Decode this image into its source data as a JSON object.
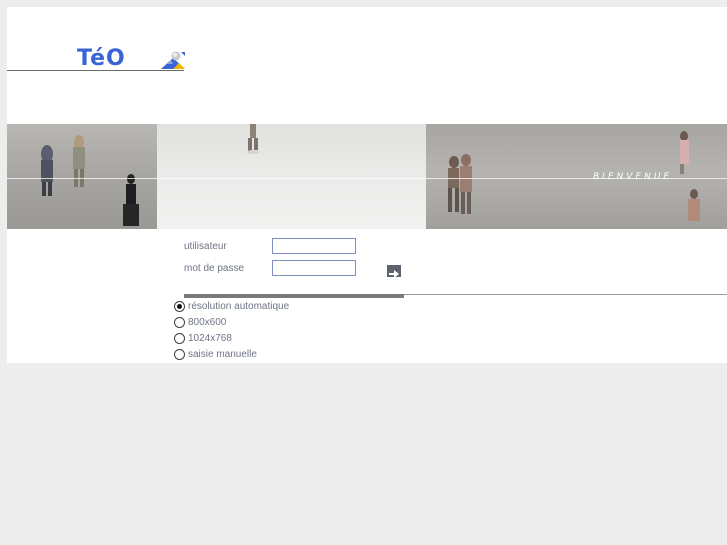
{
  "logo": {
    "text": "TéO",
    "icon": "teo-logo-icon"
  },
  "banner": {
    "caption": "BIENVENUE"
  },
  "login": {
    "user_label": "utilisateur",
    "password_label": "mot de passe",
    "user_value": "",
    "password_value": "",
    "submit_icon": "arrow-right-icon"
  },
  "resolution": {
    "options": [
      "résolution automatique",
      "800x600",
      "1024x768",
      "saisie manuelle"
    ],
    "selected": "résolution automatique"
  },
  "colors": {
    "brand": "#3a63d8",
    "label": "#6f7486",
    "field_border": "#7f8fbf",
    "background": "#ededed"
  }
}
